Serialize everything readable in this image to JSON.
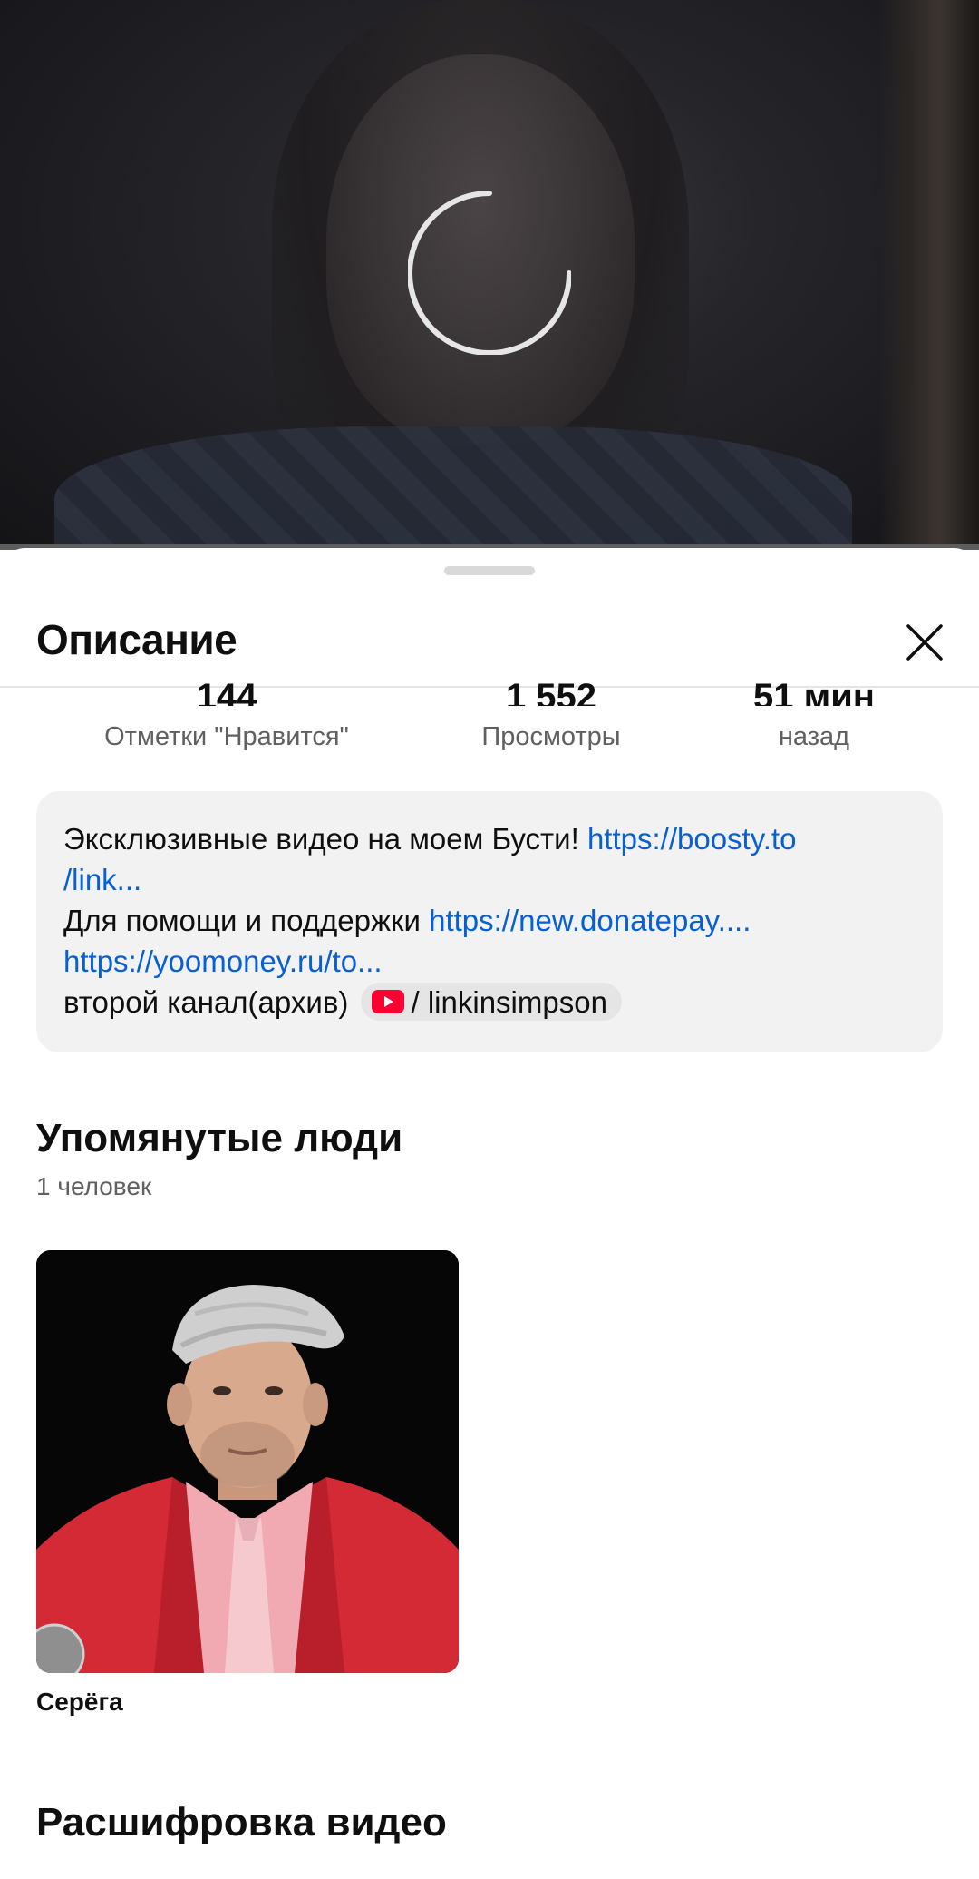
{
  "player": {
    "state": "loading"
  },
  "sheet": {
    "title": "Описание",
    "close_icon": "close-icon"
  },
  "stats": {
    "likes": {
      "value": "144",
      "label": "Отметки \"Нравится\""
    },
    "views": {
      "value": "1 552",
      "label": "Просмотры"
    },
    "time": {
      "value": "51 мин",
      "label": "назад"
    }
  },
  "description": {
    "line1_text": "Эксклюзивные видео на моем Бусти! ",
    "line1_link": "https://boosty.to",
    "line2_link": "/link...",
    "line3_text": "Для помощи и поддержки ",
    "line3_link": "https://new.donatepay....",
    "line4_link": "https://yoomoney.ru/to...",
    "line5_text": "второй канал(архив) ",
    "chip_icon": "youtube-icon",
    "chip_text": "/ linkinsimpson"
  },
  "people": {
    "title": "Упомянутые люди",
    "count": "1 человек",
    "items": [
      {
        "name": "Серёга"
      }
    ]
  },
  "transcript": {
    "title": "Расшифровка видео"
  },
  "colors": {
    "link": "#065fd4",
    "youtube_red": "#ff0033",
    "description_bg": "#f2f2f2"
  }
}
